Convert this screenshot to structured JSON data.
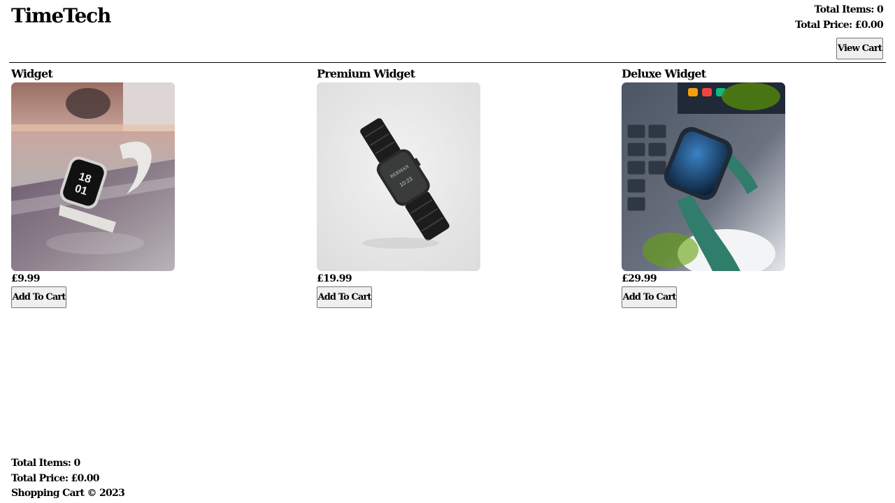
{
  "header": {
    "brand": "TimeTech",
    "total_items_label": "Total Items:",
    "total_items": "0",
    "total_price_label": "Total Price:",
    "total_price": "£0.00",
    "view_cart_label": "View Cart"
  },
  "products": [
    {
      "name": "Widget",
      "price": "£9.99",
      "add_label": "Add To Cart",
      "image": "white-sport-loop-smartwatch-photo"
    },
    {
      "name": "Premium Widget",
      "price": "£19.99",
      "add_label": "Add To Cart",
      "image": "black-link-bracelet-smartwatch-photo"
    },
    {
      "name": "Deluxe Widget",
      "price": "£29.99",
      "add_label": "Add To Cart",
      "image": "green-leather-band-smartwatch-photo"
    }
  ],
  "footer": {
    "total_items_label": "Total Items:",
    "total_items": "0",
    "total_price_label": "Total Price:",
    "total_price": "£0.00",
    "copyright": "Shopping Cart © 2023"
  }
}
